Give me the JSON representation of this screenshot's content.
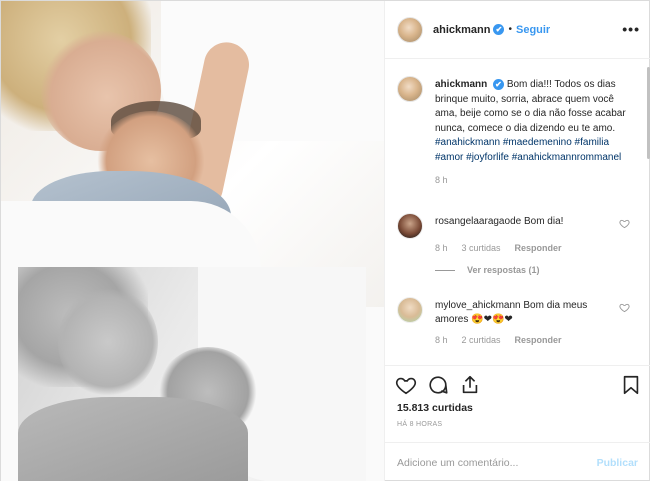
{
  "header": {
    "username": "ahickmann",
    "verified_mark": "✔",
    "separator": "•",
    "follow_label": "Seguir",
    "more_label": "•••"
  },
  "caption": {
    "username": "ahickmann",
    "verified_mark": "✔",
    "text": "Bom dia!!! Todos os dias brinque muito, sorria, abrace quem você ama, beije como se o dia não fosse acabar nunca, comece o dia dizendo eu te amo.",
    "hashtags": [
      "#anahickmann",
      "#maedemenino",
      "#familia",
      "#amor",
      "#joyforlife",
      "#anahickmannrommanel"
    ],
    "time": "8 h"
  },
  "comments": [
    {
      "username": "rosangelaaragao",
      "text": "de Bom dia!",
      "time": "8 h",
      "likes": "3 curtidas",
      "reply_label": "Responder",
      "view_replies": "Ver respostas (1)"
    },
    {
      "username": "mylove_ahickmann",
      "text": "Bom dia meus amores 😍❤😍❤",
      "time": "8 h",
      "likes": "2 curtidas",
      "reply_label": "Responder"
    }
  ],
  "actions": {
    "like_icon": "heart-icon",
    "comment_icon": "comment-icon",
    "share_icon": "share-icon",
    "save_icon": "bookmark-icon",
    "likes_count": "15.813 curtidas",
    "posted_ago": "HÁ 8 HORAS"
  },
  "add_comment": {
    "placeholder": "Adicione um comentário...",
    "publish_label": "Publicar"
  },
  "colors": {
    "accent": "#3897f0",
    "hashtag": "#003569",
    "muted": "#999999",
    "publish_disabled": "#b2dffc"
  }
}
